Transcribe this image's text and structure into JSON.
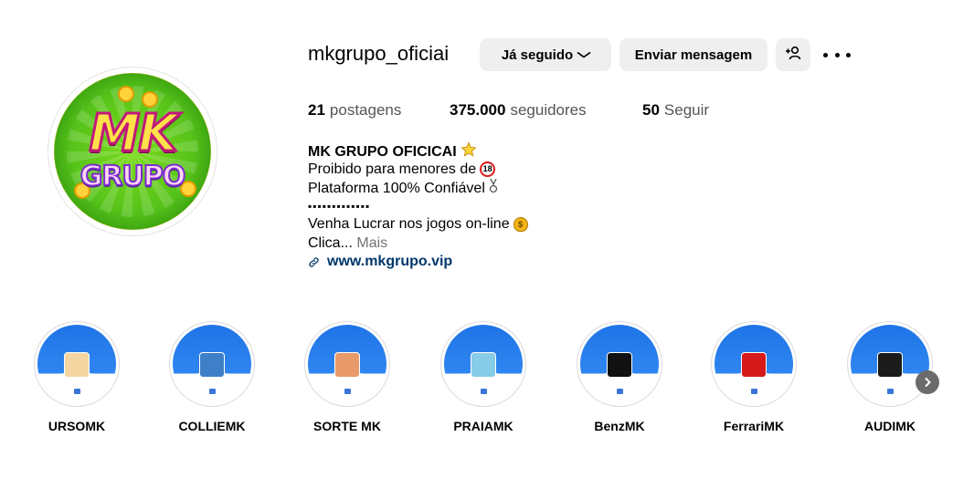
{
  "profile": {
    "username": "mkgrupo_oficiai",
    "avatar_text_top": "MK",
    "avatar_text_bottom": "GRUPO"
  },
  "actions": {
    "following_label": "Já seguido",
    "message_label": "Enviar mensagem",
    "add_user_icon": "person-add-icon",
    "more_icon": "more-options-icon"
  },
  "stats": {
    "posts_count": "21",
    "posts_label": "postagens",
    "followers_count": "375.000",
    "followers_label": "seguidores",
    "following_count": "50",
    "following_label": "Seguir"
  },
  "bio": {
    "name": "MK GRUPO OFICICAI",
    "line1": "Proibido para menores de",
    "line1_badge": "18",
    "line2": "Plataforma 100% Confiável",
    "line3": "▪▪▪▪▪▪▪▪▪▪▪▪▪",
    "line4": "Venha Lucrar nos jogos on-line",
    "line5": "Clica...",
    "more_label": "Mais",
    "link": "www.mkgrupo.vip"
  },
  "highlights": [
    {
      "label": "URSOMK",
      "thumb_color": "#f5d6a0"
    },
    {
      "label": "COLLIEMK",
      "thumb_color": "#3f7fc8"
    },
    {
      "label": "SORTE MK",
      "thumb_color": "#e89a6a"
    },
    {
      "label": "PRAIAMK",
      "thumb_color": "#88cde8"
    },
    {
      "label": "BenzMK",
      "thumb_color": "#111111"
    },
    {
      "label": "FerrariMK",
      "thumb_color": "#d61a1a"
    },
    {
      "label": "AUDIMK",
      "thumb_color": "#1b1b1b"
    }
  ],
  "colors": {
    "highlight_blue": "#2f86f0",
    "link_color": "#00376b",
    "button_bg": "#efefef"
  }
}
